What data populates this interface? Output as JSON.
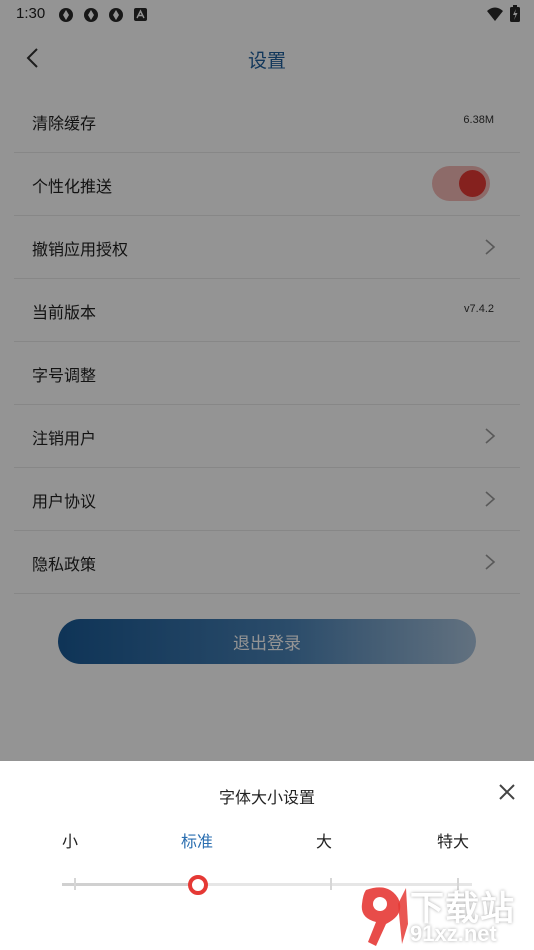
{
  "status_bar": {
    "time": "1:30",
    "notification_icons": [
      "app-notification-icon",
      "app-notification-icon",
      "app-notification-icon",
      "a-notification-icon"
    ],
    "right_icons": [
      "wifi-icon",
      "battery-icon"
    ]
  },
  "header": {
    "title": "设置",
    "back_icon": "chevron-left-icon"
  },
  "settings": {
    "items": [
      {
        "label": "清除缓存",
        "value": "6.38M"
      },
      {
        "label": "个性化推送",
        "toggle_on": true
      },
      {
        "label": "撤销应用授权",
        "icon": "chevron-right-icon"
      },
      {
        "label": "当前版本",
        "value": "v7.4.2"
      },
      {
        "label": "字号调整"
      },
      {
        "label": "注销用户",
        "icon": "chevron-right-icon"
      },
      {
        "label": "用户协议",
        "icon": "chevron-right-icon"
      },
      {
        "label": "隐私政策",
        "icon": "chevron-right-icon"
      }
    ]
  },
  "logout": {
    "label": "退出登录"
  },
  "font_sheet": {
    "title": "字体大小设置",
    "close_icon": "close-icon",
    "options": [
      "小",
      "标准",
      "大",
      "特大"
    ],
    "selected": "标准"
  },
  "watermark": {
    "text_top": "下载站",
    "text_bottom": "91xz.net"
  },
  "colors": {
    "accent": "#1f5f9e",
    "toggle": "#e53935",
    "thumb": "#e53935"
  }
}
